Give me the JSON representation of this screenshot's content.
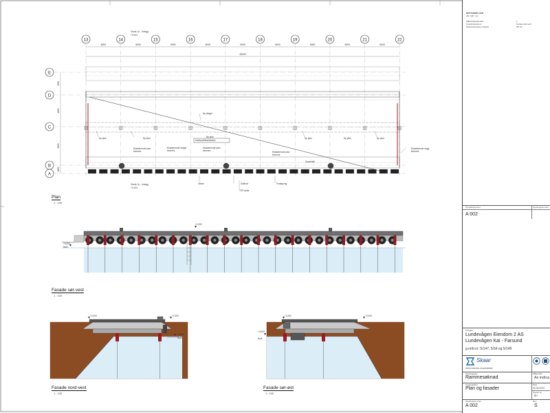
{
  "grid_columns": [
    "13",
    "14",
    "15",
    "16",
    "17",
    "18",
    "19",
    "20",
    "21",
    "22"
  ],
  "grid_rows": [
    "E",
    "D",
    "C",
    "B",
    "A"
  ],
  "dim_spacing": "5000",
  "dim_total": "45000",
  "row_dims": [
    "2950",
    "4850",
    "5000",
    "1850",
    "800"
  ],
  "annotations": {
    "fender": "Ny plan",
    "fender_existing": "Eksisterende plan beveres",
    "existing_drag": "Eksisterende drager beveres",
    "new_drag": "Ny drager",
    "bearing": "Kaifront/beskrivelse",
    "ladder": "Leider",
    "bollard": "Fortøyning",
    "quay_edge": "Kaifront",
    "quay_top": "Nytt kaidekke",
    "pile": "TOP pelar",
    "existing_wall": "Eksisterende vegg beveres",
    "kryssbalk": "Kryssbalk",
    "topp": "Overk. fy. - innegg",
    "topp_level": "+3,103",
    "level_2200": "+2,200",
    "level_plus": "+0,000",
    "level_label": "Nivå"
  },
  "views": {
    "plan": {
      "title": "Plan",
      "scale": "1 : 100"
    },
    "sw": {
      "title": "Fasade sør-vest",
      "scale": "1 : 100"
    },
    "nw": {
      "title": "Fasade nord-vest",
      "scale": "1 : 100"
    },
    "se": {
      "title": "Fasade sør-øst",
      "scale": "1 : 100"
    }
  },
  "title_block": {
    "top_header": "BESTEMMELSER",
    "top_sub": "Alle mål i mm",
    "top_rows": [
      {
        "k": "Målestokkstandard",
        "v": "1"
      },
      {
        "k": "Koordinatsystem",
        "v": "Norske kartl.soft"
      },
      {
        "k": "Referansesystem Høyde",
        "v": "NN 31"
      }
    ],
    "mid_header_left": "Prosjektnummer",
    "mid_header_right": "Tegningsnummer",
    "mid_number": "A 002",
    "project_label": "Prosjekt",
    "project_line1": "Lundevågen Eiendom 2 AS",
    "project_line2": "Lundevågen Kai - Farsund",
    "project_line3": "g.nr/b.nr: 5/147, 5/34 og 5/149",
    "company": "Skaar",
    "company_sub": "RÅDGIVENDE INGENIØRER",
    "doc_type_label": "Tegningstype",
    "doc_type": "Rammesøknad",
    "scale_label": "Målestokk",
    "scale_value": "As indica",
    "drawing_title_label": "Tegningstittel",
    "drawing_title": "Plan og fasader",
    "date_label": "Dato",
    "date_value": "04.06.2024",
    "drawn_label": "Tegnet av",
    "drawn_value": "BH",
    "number_label": "Tegningsnummer",
    "number_value": "A 002",
    "rev_label": "Rev",
    "rev_value": "S"
  }
}
